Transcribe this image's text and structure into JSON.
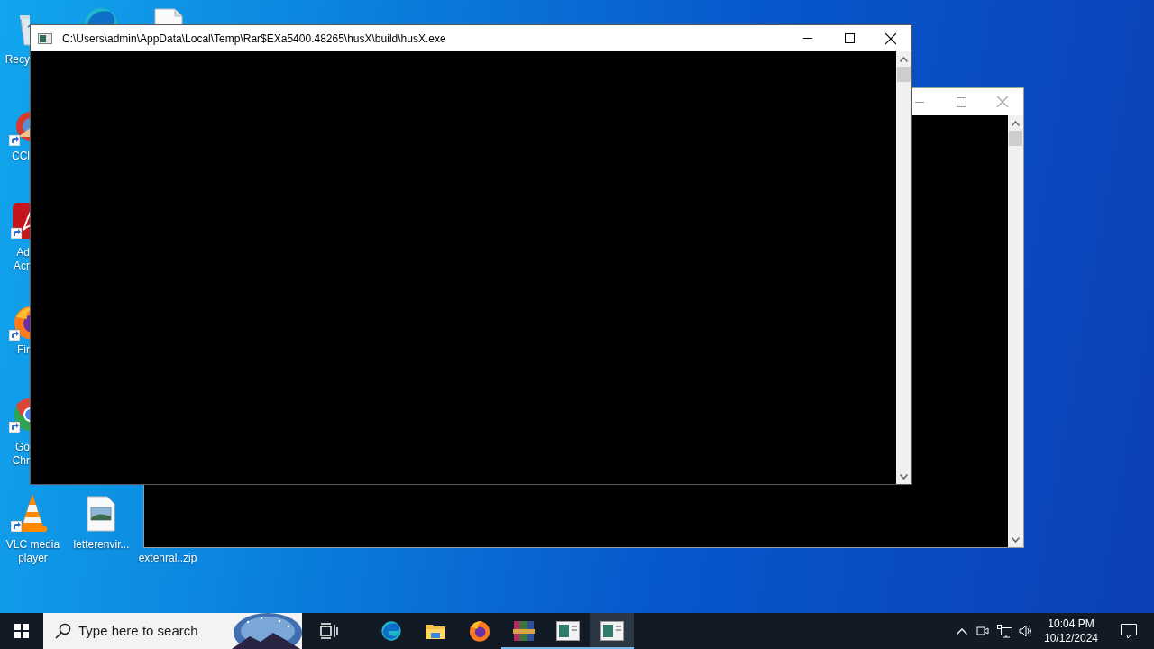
{
  "desktop": {
    "icons": [
      {
        "kind": "recycle-bin",
        "label": "Recy"
      },
      {
        "kind": "edge"
      },
      {
        "kind": "document"
      },
      {
        "kind": "ccleaner",
        "label": "CCl"
      },
      {
        "kind": "acrobat",
        "label": "Ad\nAcr"
      },
      {
        "kind": "firefox",
        "label": "Fir"
      },
      {
        "kind": "chrome",
        "label": "Go\nChr"
      },
      {
        "kind": "vlc",
        "label": "VLC media player"
      },
      {
        "kind": "image-file",
        "label": "letterenvir..."
      },
      {
        "kind": "zip",
        "label": "extenral..zip"
      }
    ]
  },
  "windows": [
    {
      "active": false
    },
    {
      "title": "C:\\Users\\admin\\AppData\\Local\\Temp\\Rar$EXa5400.48265\\husX\\build\\husX.exe",
      "active": true
    }
  ],
  "taskbar": {
    "search": {
      "placeholder": "Type here to search"
    },
    "apps": [
      {
        "kind": "task-view",
        "running": false,
        "selected": false
      },
      {
        "kind": "edge",
        "running": false,
        "selected": false
      },
      {
        "kind": "explorer",
        "running": false,
        "selected": false
      },
      {
        "kind": "firefox",
        "running": false,
        "selected": false
      },
      {
        "kind": "winrar",
        "running": true,
        "selected": false
      },
      {
        "kind": "console",
        "running": true,
        "selected": false
      },
      {
        "kind": "console",
        "running": true,
        "selected": true
      }
    ],
    "clock": {
      "time": "10:04 PM",
      "date": "10/12/2024"
    }
  }
}
